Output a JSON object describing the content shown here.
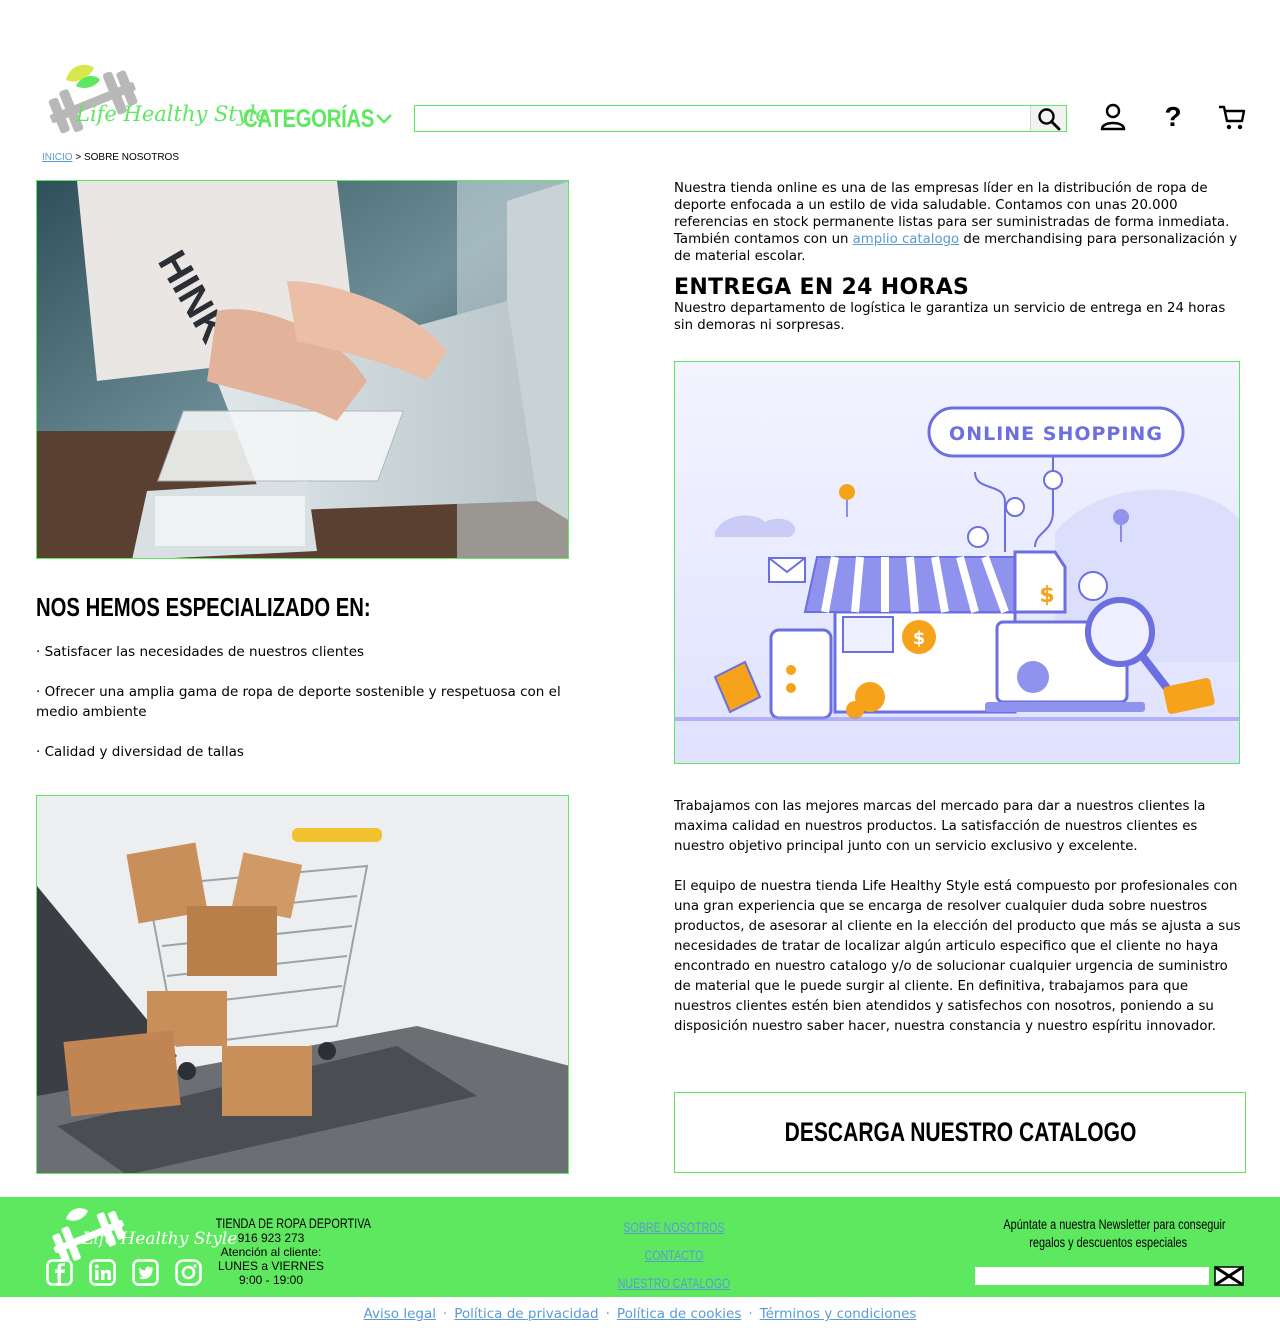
{
  "header": {
    "logo_text": "Life Healthy Style",
    "categories_label": "CATEGORÍAS",
    "search_placeholder": ""
  },
  "breadcrumb": {
    "home": "INICIO",
    "separator": ">",
    "current": "SOBRE NOSOTROS"
  },
  "specialized": {
    "title": "NOS HEMOS ESPECIALIZADO EN:",
    "items": [
      "· Satisfacer las necesidades de nuestros clientes",
      "· Ofrecer una amplia gama de ropa de deporte sostenible y respetuosa con el medio ambiente",
      "· Calidad y diversidad de tallas"
    ]
  },
  "intro": {
    "text_before": "Nuestra tienda online es una de las empresas líder en la distribución de ropa de deporte enfocada a un estilo de vida saludable. Contamos con unas 20.000 referencias en stock permanente listas para ser suministradas de forma inmediata. También contamos con un ",
    "link": "amplio catalogo",
    "text_after": " de merchandising para personalización y de material escolar."
  },
  "delivery": {
    "title": "ENTREGA EN 24 HORAS",
    "text": "Nuestro departamento de logística le garantiza un servicio de entrega en 24 horas sin demoras ni sorpresas."
  },
  "illustration": {
    "banner": "ONLINE SHOPPING"
  },
  "brands_paragraph": "Trabajamos con las mejores marcas del mercado para dar a nuestros clientes la maxima calidad en nuestros productos. La satisfacción de nuestros clientes es nuestro objetivo principal junto con un servicio exclusivo y excelente.",
  "team_paragraph": "El equipo de nuestra tienda Life Healthy Style está compuesto por profesionales con una gran experiencia que se encarga de resolver cualquier duda sobre nuestros productos, de asesorar al cliente en la elección del producto que más se ajusta a sus necesidades de tratar de localizar algún articulo especifico que el cliente no haya encontrado en nuestro catalogo y/o de solucionar  cualquier urgencia de suministro de material que le puede surgir al cliente. En definitiva, trabajamos para que nuestros clientes estén bien atendidos y satisfechos con nosotros, poniendo a su disposición nuestro saber hacer, nuestra constancia y nuestro espíritu innovador.",
  "catalog_button": "DESCARGA NUESTRO CATALOGO",
  "footer": {
    "logo_text": "Life Healthy Style",
    "store_title": "TIENDA DE ROPA DEPORTIVA",
    "phone": "916 923 273",
    "attention": "Atención al cliente:",
    "days": "LUNES a VIERNES",
    "hours": "9:00 - 19:00",
    "links": [
      "SOBRE NOSOTROS",
      "CONTACTO",
      "NUESTRO CATALOGO"
    ],
    "newsletter_line1": "Apúntate a nuestra Newsletter para conseguir",
    "newsletter_line2": "regalos y descuentos especiales"
  },
  "legal": {
    "links": [
      "Aviso legal",
      "Política de privacidad",
      "Política de cookies",
      "Términos y condiciones"
    ],
    "separator": "·"
  },
  "colors": {
    "brand_green": "#5ee860",
    "link_blue": "#5b9bd5",
    "illustration_purple": "#6b6fe0"
  },
  "icons": [
    "dumbbell-leaf-logo",
    "chevron-down-icon",
    "search-icon",
    "user-icon",
    "help-icon",
    "cart-icon",
    "facebook-icon",
    "linkedin-icon",
    "twitter-icon",
    "instagram-icon",
    "send-mail-icon"
  ]
}
